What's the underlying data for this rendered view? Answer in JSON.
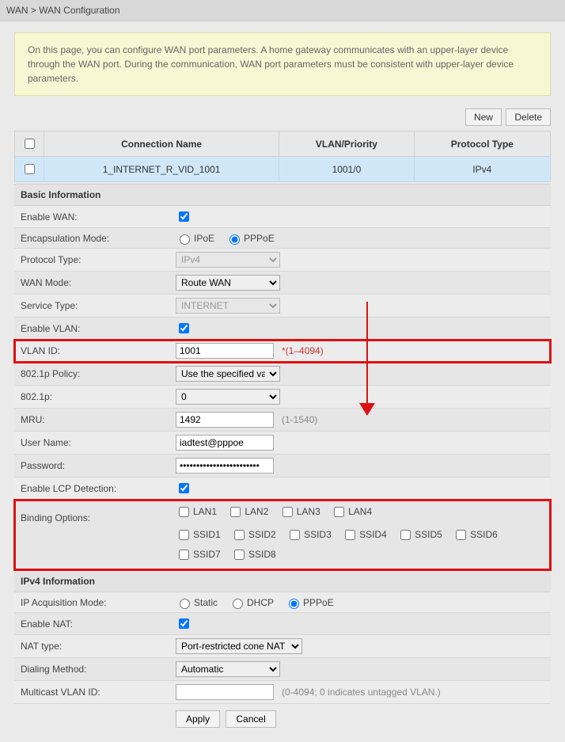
{
  "breadcrumb": "WAN > WAN Configuration",
  "info_text": "On this page, you can configure WAN port parameters. A home gateway communicates with an upper-layer device through the WAN port. During the communication, WAN port parameters must be consistent with upper-layer device parameters.",
  "toolbar": {
    "new": "New",
    "delete": "Delete"
  },
  "table": {
    "headers": {
      "name": "Connection Name",
      "vlan": "VLAN/Priority",
      "proto": "Protocol Type"
    },
    "row": {
      "name": "1_INTERNET_R_VID_1001",
      "vlan": "1001/0",
      "proto": "IPv4"
    }
  },
  "sections": {
    "basic": "Basic Information",
    "ipv4": "IPv4 Information"
  },
  "labels": {
    "enable_wan": "Enable WAN:",
    "encap": "Encapsulation Mode:",
    "proto": "Protocol Type:",
    "wan_mode": "WAN Mode:",
    "service": "Service Type:",
    "enable_vlan": "Enable VLAN:",
    "vlan_id": "VLAN ID:",
    "dot1p_policy": "802.1p Policy:",
    "dot1p": "802.1p:",
    "mru": "MRU:",
    "user": "User Name:",
    "pass": "Password:",
    "lcp": "Enable LCP Detection:",
    "binding": "Binding Options:",
    "ip_acq": "IP Acquisition Mode:",
    "enable_nat": "Enable NAT:",
    "nat_type": "NAT type:",
    "dialing": "Dialing Method:",
    "mcast": "Multicast VLAN ID:"
  },
  "values": {
    "encap": {
      "ipoe": "IPoE",
      "pppoe": "PPPoE"
    },
    "proto": "IPv4",
    "wan_mode": "Route WAN",
    "service": "INTERNET",
    "vlan_id": "1001",
    "vlan_hint": "*(1–4094)",
    "dot1p_policy": "Use the specified value",
    "dot1p": "0",
    "mru": "1492",
    "mru_hint": "(1-1540)",
    "user": "iadtest@pppoe",
    "pass": "••••••••••••••••••••••••",
    "binding": {
      "lan": [
        "LAN1",
        "LAN2",
        "LAN3",
        "LAN4"
      ],
      "ssid": [
        "SSID1",
        "SSID2",
        "SSID3",
        "SSID4",
        "SSID5",
        "SSID6",
        "SSID7",
        "SSID8"
      ]
    },
    "ip_acq": {
      "static": "Static",
      "dhcp": "DHCP",
      "pppoe": "PPPoE"
    },
    "nat_type": "Port-restricted cone NAT",
    "dialing": "Automatic",
    "mcast": "",
    "mcast_hint": "(0-4094; 0 indicates untagged VLAN.)"
  },
  "buttons": {
    "apply": "Apply",
    "cancel": "Cancel"
  }
}
